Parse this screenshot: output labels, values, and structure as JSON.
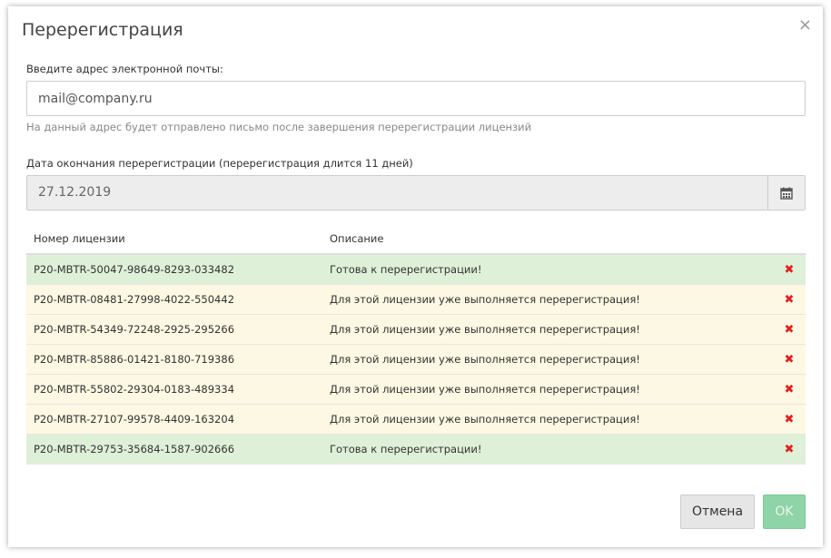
{
  "dialog": {
    "title": "Перерегистрация",
    "close_glyph": "×"
  },
  "email": {
    "label": "Введите адрес электронной почты:",
    "placeholder": "mail@company.ru",
    "hint": "На данный адрес будет отправлено письмо после завершения перерегистрации лицензий"
  },
  "date": {
    "label": "Дата окончания перерегистрации (перерегистрация длится 11 дней)",
    "value": "27.12.2019",
    "icon": "calendar-icon"
  },
  "table": {
    "headers": [
      "Номер лицензии",
      "Описание"
    ],
    "rows": [
      {
        "license": "P20-MBTR-50047-98649-8293-033482",
        "description": "Готова к перерегистрации!",
        "status": "ready"
      },
      {
        "license": "P20-MBTR-08481-27998-4022-550442",
        "description": "Для этой лицензии уже выполняется перерегистрация!",
        "status": "busy"
      },
      {
        "license": "P20-MBTR-54349-72248-2925-295266",
        "description": "Для этой лицензии уже выполняется перерегистрация!",
        "status": "busy"
      },
      {
        "license": "P20-MBTR-85886-01421-8180-719386",
        "description": "Для этой лицензии уже выполняется перерегистрация!",
        "status": "busy"
      },
      {
        "license": "P20-MBTR-55802-29304-0183-489334",
        "description": "Для этой лицензии уже выполняется перерегистрация!",
        "status": "busy"
      },
      {
        "license": "P20-MBTR-27107-99578-4409-163204",
        "description": "Для этой лицензии уже выполняется перерегистрация!",
        "status": "busy"
      },
      {
        "license": "P20-MBTR-29753-35684-1587-902666",
        "description": "Готова к перерегистрации!",
        "status": "ready"
      }
    ],
    "delete_glyph": "✖"
  },
  "footer": {
    "cancel_label": "Отмена",
    "ok_label": "OK"
  },
  "colors": {
    "ready_row": "#dff0d8",
    "busy_row": "#fcf8e3",
    "delete_icon": "#e02020",
    "ok_button": "#8fd3a8"
  }
}
